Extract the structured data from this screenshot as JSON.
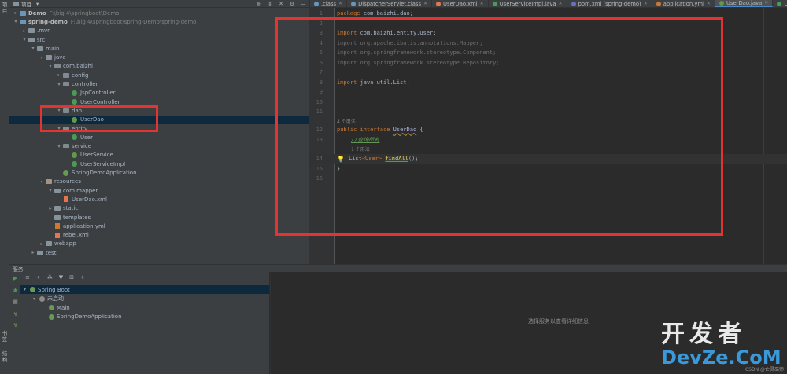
{
  "left_strip": {
    "labels": [
      "项目",
      "书签",
      "结构"
    ]
  },
  "project": {
    "header_title": "项目",
    "rows": [
      {
        "label": "Demo",
        "path": "F:\\big 4\\springboot\\Demo",
        "depth": 0,
        "icon": "module-icon",
        "arrow": "▸",
        "bold": true
      },
      {
        "label": "spring-demo",
        "path": "F:\\big 4\\springboot\\spring-Demo\\spring-demo",
        "depth": 0,
        "icon": "module-icon",
        "arrow": "▾",
        "bold": true
      },
      {
        "label": ".mvn",
        "path": "",
        "depth": 1,
        "icon": "folder-icon",
        "arrow": "▸"
      },
      {
        "label": "src",
        "path": "",
        "depth": 1,
        "icon": "folder-icon",
        "arrow": "▾"
      },
      {
        "label": "main",
        "path": "",
        "depth": 2,
        "icon": "folder-icon",
        "arrow": "▾"
      },
      {
        "label": "java",
        "path": "",
        "depth": 3,
        "icon": "folder-icon",
        "arrow": "▾"
      },
      {
        "label": "com.baizhi",
        "path": "",
        "depth": 4,
        "icon": "package-icon",
        "arrow": "▾"
      },
      {
        "label": "config",
        "path": "",
        "depth": 5,
        "icon": "package-icon",
        "arrow": "▸"
      },
      {
        "label": "controller",
        "path": "",
        "depth": 5,
        "icon": "package-icon",
        "arrow": "▾"
      },
      {
        "label": "JspController",
        "path": "",
        "depth": 6,
        "icon": "class-icon",
        "arrow": ""
      },
      {
        "label": "UserController",
        "path": "",
        "depth": 6,
        "icon": "class-icon",
        "arrow": ""
      },
      {
        "label": "dao",
        "path": "",
        "depth": 5,
        "icon": "package-icon",
        "arrow": "▾"
      },
      {
        "label": "UserDao",
        "path": "",
        "depth": 6,
        "icon": "interface-icon",
        "arrow": "",
        "selected": true
      },
      {
        "label": "entity",
        "path": "",
        "depth": 5,
        "icon": "package-icon",
        "arrow": "▾"
      },
      {
        "label": "User",
        "path": "",
        "depth": 6,
        "icon": "class-icon",
        "arrow": ""
      },
      {
        "label": "service",
        "path": "",
        "depth": 5,
        "icon": "package-icon",
        "arrow": "▾"
      },
      {
        "label": "UserService",
        "path": "",
        "depth": 6,
        "icon": "interface-icon",
        "arrow": ""
      },
      {
        "label": "UserServiceImpl",
        "path": "",
        "depth": 6,
        "icon": "class-icon",
        "arrow": ""
      },
      {
        "label": "SpringDemoApplication",
        "path": "",
        "depth": 5,
        "icon": "spring-icon",
        "arrow": ""
      },
      {
        "label": "resources",
        "path": "",
        "depth": 3,
        "icon": "resources-icon",
        "arrow": "▾"
      },
      {
        "label": "com.mapper",
        "path": "",
        "depth": 4,
        "icon": "folder-icon",
        "arrow": "▾"
      },
      {
        "label": "UserDao.xml",
        "path": "",
        "depth": 5,
        "icon": "xml-icon",
        "arrow": ""
      },
      {
        "label": "static",
        "path": "",
        "depth": 4,
        "icon": "folder-icon",
        "arrow": "▸"
      },
      {
        "label": "templates",
        "path": "",
        "depth": 4,
        "icon": "folder-icon",
        "arrow": ""
      },
      {
        "label": "application.yml",
        "path": "",
        "depth": 4,
        "icon": "yml-icon",
        "arrow": ""
      },
      {
        "label": "rebel.xml",
        "path": "",
        "depth": 4,
        "icon": "xml-icon",
        "arrow": ""
      },
      {
        "label": "webapp",
        "path": "",
        "depth": 3,
        "icon": "folder-icon",
        "arrow": "▸"
      },
      {
        "label": "test",
        "path": "",
        "depth": 2,
        "icon": "folder-icon",
        "arrow": "▸"
      }
    ]
  },
  "tabs": [
    {
      "label": ".class",
      "icon_color": "#6897bb"
    },
    {
      "label": "DispatcherServlet.class",
      "icon_color": "#6897bb"
    },
    {
      "label": "UserDao.xml",
      "icon_color": "#e8754a"
    },
    {
      "label": "UserServiceImpl.java",
      "icon_color": "#499c54"
    },
    {
      "label": "pom.xml (spring-demo)",
      "icon_color": "#6a6fbf"
    },
    {
      "label": "application.yml",
      "icon_color": "#cc7832"
    },
    {
      "label": "UserDao.java",
      "icon_color": "#5d9b47",
      "active": true
    },
    {
      "label": "User.java",
      "icon_color": "#499c54"
    }
  ],
  "editor": {
    "hint_usages_4": "4 个用法",
    "hint_usages_1": "1 个用法",
    "lines": {
      "l1": "1",
      "l2": "2",
      "l3": "3",
      "l4": "4",
      "l5": "5",
      "l6": "6",
      "l7": "7",
      "l8": "8",
      "l9": "9",
      "l10": "10",
      "l11": "11",
      "l12": "12",
      "l13": "13",
      "l14": "14",
      "l15": "15",
      "l16": "16"
    },
    "code": {
      "package_kw": "package",
      "package_name": " com.baizhi.dao;",
      "import_kw": "import",
      "import_user": " com.baizhi.entity.User;",
      "import_mapper": "import org.apache.ibatis.annotations.Mapper;",
      "import_component": "import org.springframework.stereotype.Component;",
      "import_repository": "import org.springframework.stereotype.Repository;",
      "import_list": " java.util.List;",
      "public_interface": "public interface ",
      "interface_name": "UserDao",
      "open_brace": " {",
      "comment": "//查询所有",
      "list_type": "List",
      "generic": "<User>",
      "method": "findAll",
      "method_tail": "();",
      "close_brace": "}"
    }
  },
  "services": {
    "title": "服务",
    "toolbar": [
      "≡",
      "÷",
      "⁂",
      "▼",
      "⊞",
      "+"
    ],
    "rows": [
      {
        "label": "Spring Boot",
        "depth": 0,
        "arrow": "▾",
        "selected": true
      },
      {
        "label": "未启动",
        "depth": 1,
        "arrow": "▾"
      },
      {
        "label": "Main",
        "depth": 2,
        "arrow": ""
      },
      {
        "label": "SpringDemoApplication",
        "depth": 2,
        "arrow": ""
      }
    ],
    "detail_message": "选择服务以查看详细信息"
  },
  "watermark": {
    "cn": "开发者",
    "en": "DevZe.CoM",
    "small": "CSDN @亡灵巫师"
  },
  "colors": {
    "highlight": "#e3342f",
    "selection": "#0d293e",
    "accent": "#4a88c7"
  }
}
